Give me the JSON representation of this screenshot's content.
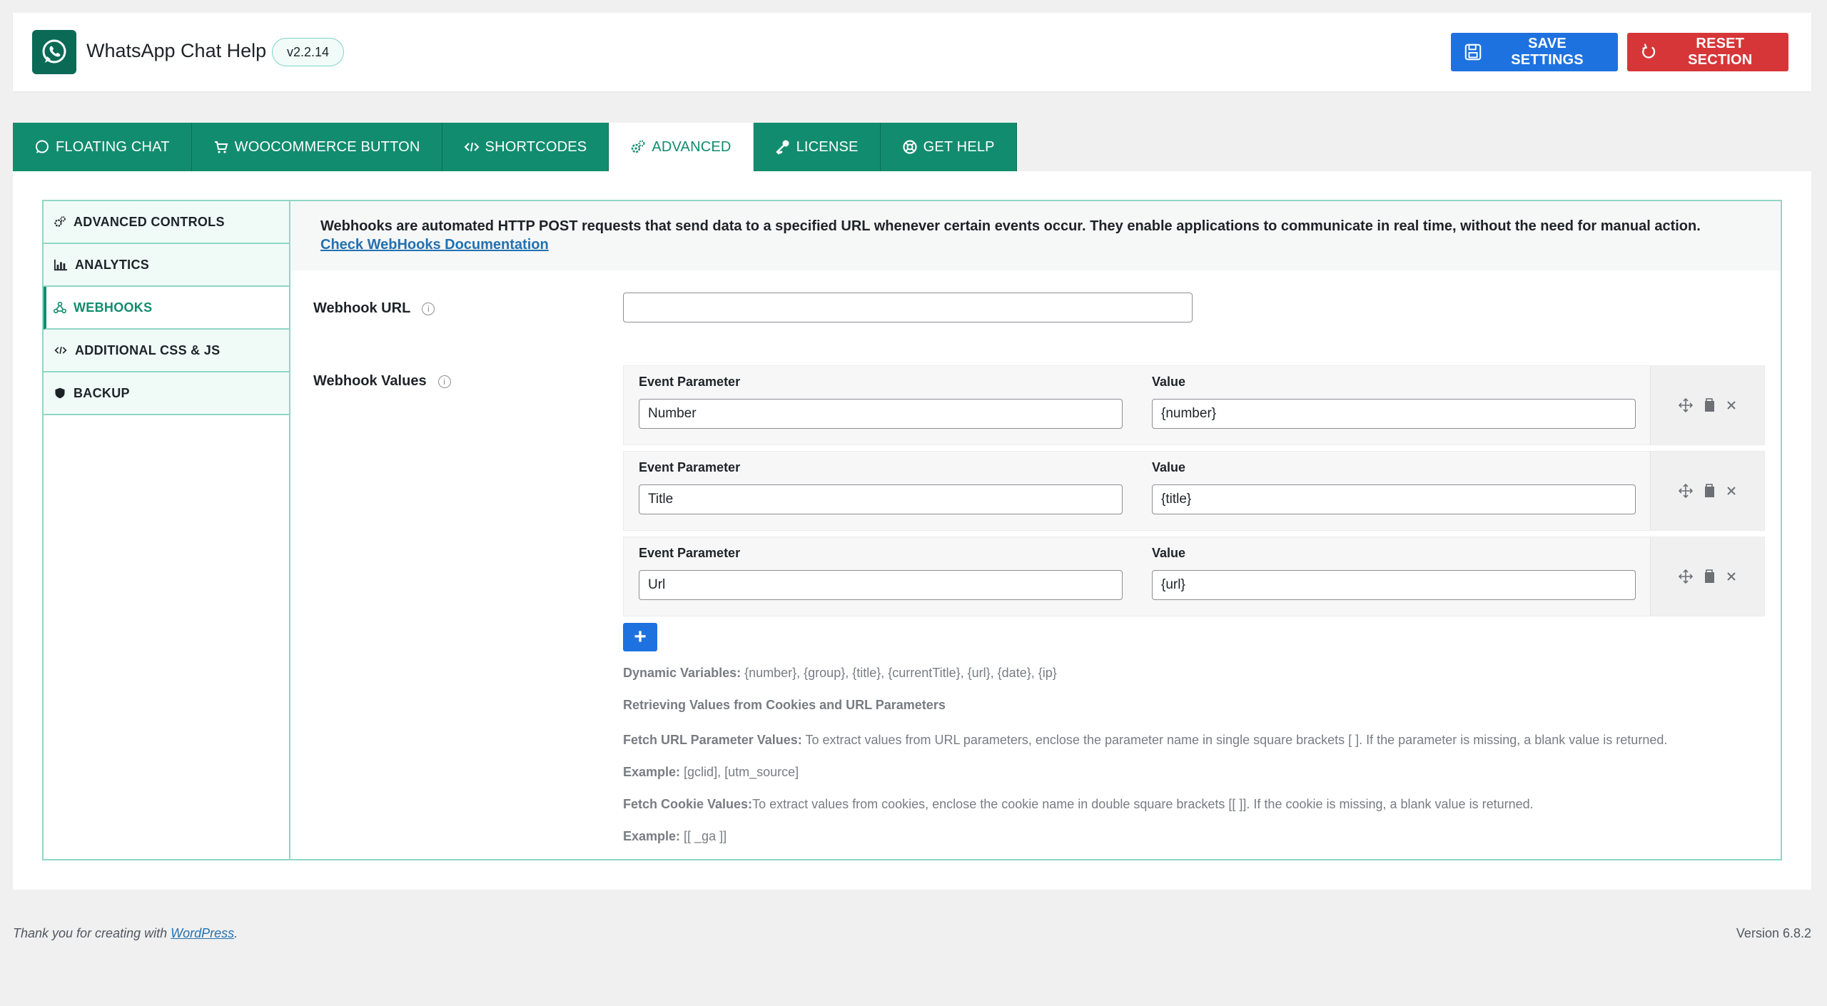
{
  "header": {
    "app_title": "WhatsApp Chat Help",
    "version": "v2.2.14",
    "save_label": "SAVE SETTINGS",
    "reset_label": "RESET SECTION",
    "colors": {
      "brand": "#0b6a56",
      "save": "#1e72e0",
      "reset": "#d63638"
    }
  },
  "tabs": [
    {
      "label": "FLOATING CHAT",
      "icon": "whatsapp-icon"
    },
    {
      "label": "WOOCOMMERCE BUTTON",
      "icon": "cart-icon"
    },
    {
      "label": "SHORTCODES",
      "icon": "code-icon"
    },
    {
      "label": "ADVANCED",
      "icon": "gears-icon",
      "active": true
    },
    {
      "label": "LICENSE",
      "icon": "key-icon"
    },
    {
      "label": "GET HELP",
      "icon": "lifebuoy-icon"
    }
  ],
  "sidebar": {
    "items": [
      {
        "label": "ADVANCED CONTROLS",
        "icon": "gears-icon"
      },
      {
        "label": "ANALYTICS",
        "icon": "chart-icon"
      },
      {
        "label": "WEBHOOKS",
        "icon": "webhook-icon",
        "active": true
      },
      {
        "label": "ADDITIONAL CSS & JS",
        "icon": "code-icon"
      },
      {
        "label": "BACKUP",
        "icon": "shield-icon"
      }
    ]
  },
  "notice": {
    "text": "Webhooks are automated HTTP POST requests that send data to a specified URL whenever certain events occur. They enable applications to communicate in real time, without the need for manual action. ",
    "link_text": "Check WebHooks Documentation"
  },
  "form": {
    "webhook_url_label": "Webhook URL",
    "webhook_url_value": "",
    "webhook_values_label": "Webhook Values",
    "param_label": "Event Parameter",
    "value_label": "Value",
    "rows": [
      {
        "param": "Number",
        "value": "{number}"
      },
      {
        "param": "Title",
        "value": "{title}"
      },
      {
        "param": "Url",
        "value": "{url}"
      }
    ],
    "add_label": "+"
  },
  "help": {
    "dynamic_label": "Dynamic Variables:",
    "dynamic_text": " {number}, {group}, {title}, {currentTitle}, {url}, {date}, {ip}",
    "retrieving_title": "Retrieving Values from Cookies and URL Parameters",
    "fetch_url_label": "Fetch URL Parameter Values:",
    "fetch_url_text": " To extract values from URL parameters, enclose the parameter name in single square brackets [ ]. If the parameter is missing, a blank value is returned.",
    "example_label": "Example:",
    "example_url_text": " [gclid], [utm_source]",
    "fetch_cookie_label": "Fetch Cookie Values:",
    "fetch_cookie_text": "To extract values from cookies, enclose the cookie name in double square brackets [[ ]]. If the cookie is missing, a blank value is returned.",
    "example_cookie_text": " [[ _ga ]]"
  },
  "footer": {
    "thanks_text": "Thank you for creating with ",
    "wp_link": "WordPress",
    "period": ".",
    "version": "Version 6.8.2"
  }
}
